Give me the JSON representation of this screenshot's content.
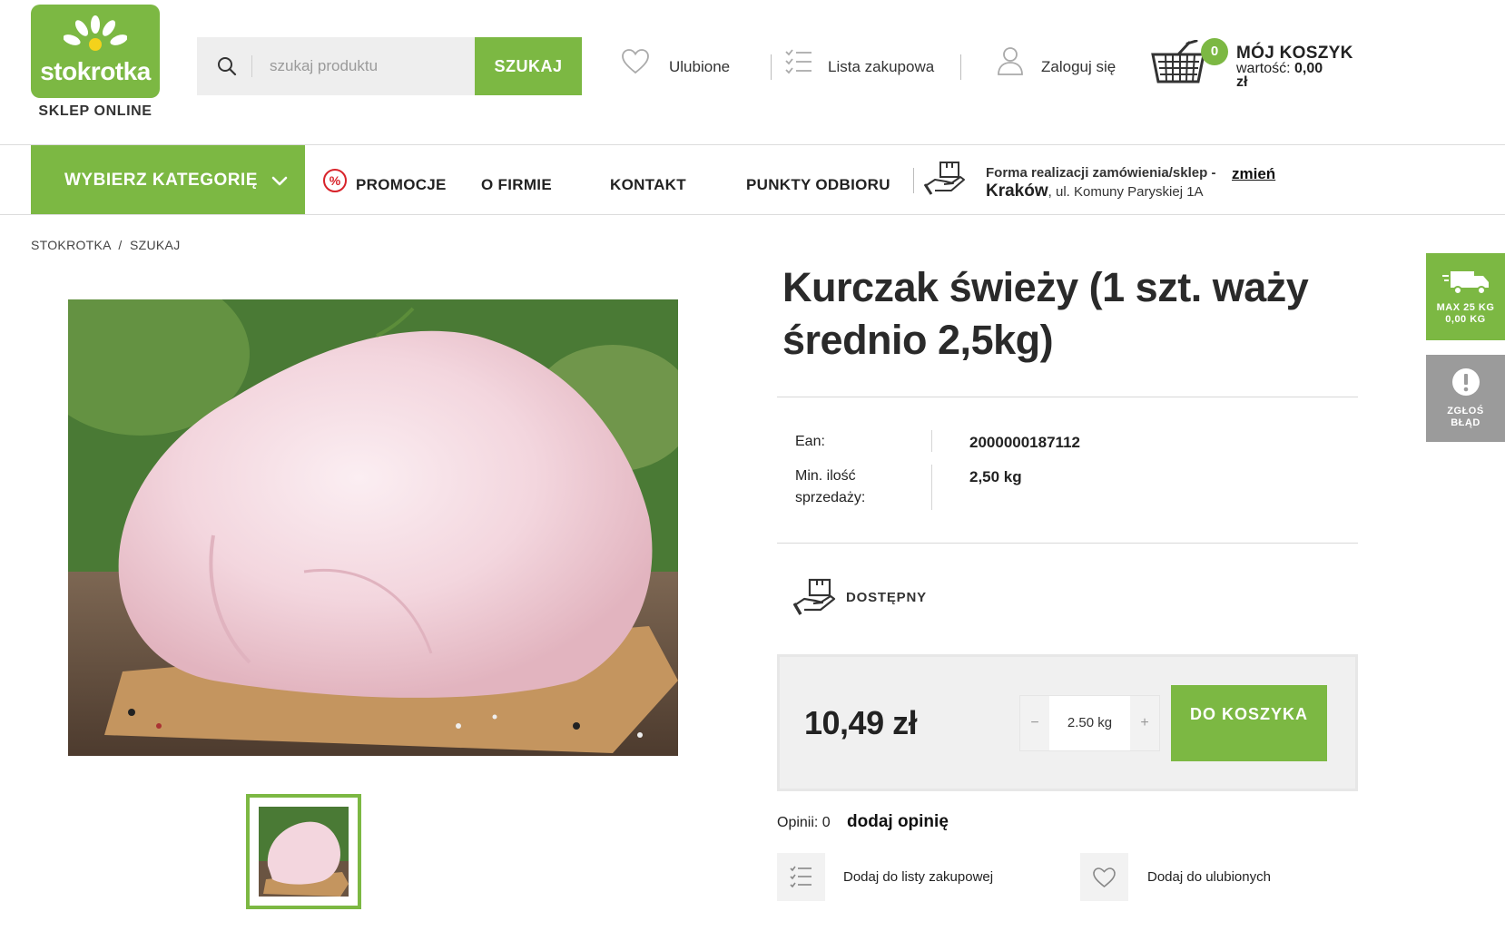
{
  "header": {
    "logo_text": "stokrotka",
    "logo_subtitle": "SKLEP ONLINE",
    "search": {
      "placeholder": "szukaj produktu",
      "button": "SZUKAJ"
    },
    "favorites": "Ulubione",
    "shopping_list": "Lista zakupowa",
    "login": "Zaloguj się",
    "cart": {
      "count": "0",
      "title": "MÓJ KOSZYK",
      "value_label": "wartość:",
      "value": "0,00",
      "currency": "zł"
    }
  },
  "nav": {
    "category_button": "WYBIERZ KATEGORIĘ",
    "items": [
      "PROMOCJE",
      "O FIRMIE",
      "KONTAKT",
      "PUNKTY ODBIORU"
    ],
    "fulfilment": {
      "title": "Forma realizacji zamówienia/sklep -",
      "change": "zmień",
      "city": "Kraków",
      "address": ", ul. Komuny Paryskiej 1A"
    }
  },
  "breadcrumb": [
    "STOKROTKA",
    "/",
    "SZUKAJ"
  ],
  "product": {
    "title": "Kurczak świeży (1 szt. waży średnio 2,5kg)",
    "attributes": [
      {
        "label": "Ean:",
        "value": "2000000187112"
      },
      {
        "label": "Min. ilość sprzedaży:",
        "value": "2,50 kg"
      }
    ],
    "availability": "DOSTĘPNY",
    "price": "10,49 zł",
    "quantity": "2.50 kg",
    "qty_minus": "−",
    "qty_plus": "+",
    "add_to_cart": "DO KOSZYKA",
    "opinions_label": "Opinii: 0",
    "add_opinion": "dodaj opinię",
    "add_to_list": "Dodaj do listy zakupowej",
    "add_to_favorites": "Dodaj do ulubionych"
  },
  "side_tabs": {
    "delivery": {
      "line1": "MAX 25 KG",
      "line2": "0,00 KG"
    },
    "report": {
      "line1": "ZGŁOŚ",
      "line2": "BŁĄD"
    }
  },
  "colors": {
    "brand_green": "#7cb843",
    "promo_red": "#d8232a"
  }
}
